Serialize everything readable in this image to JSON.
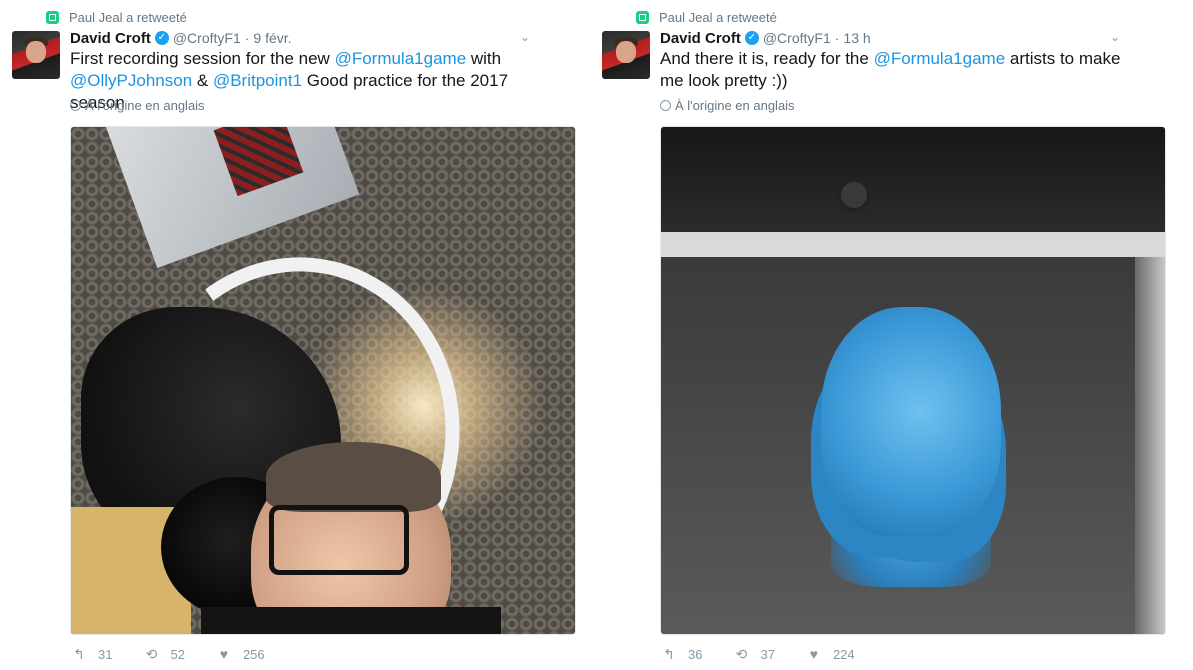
{
  "tweets": [
    {
      "retweet_label": "Paul Jeal a retweeté",
      "author": {
        "name": "David Croft",
        "handle": "@CroftyF1"
      },
      "time": "9 févr.",
      "text_parts": [
        {
          "t": "First recording session for the new "
        },
        {
          "t": "@Formula1game"
        },
        {
          "t": " with "
        },
        {
          "t": "@OllyPJohnson"
        },
        {
          "t": " & "
        },
        {
          "t": "@Britpoint1"
        },
        {
          "t": " Good practice for the 2017 season"
        }
      ],
      "translate": "À l'origine en anglais",
      "counts": {
        "replies": "31",
        "retweets": "52",
        "likes": "256"
      }
    },
    {
      "retweet_label": "Paul Jeal a retweeté",
      "author": {
        "name": "David Croft",
        "handle": "@CroftyF1"
      },
      "time": "13 h",
      "text_parts": [
        {
          "t": "And there it is, ready for the "
        },
        {
          "t": "@Formula1game"
        },
        {
          "t": " artists to make me look pretty :))"
        }
      ],
      "translate": "À l'origine en anglais",
      "counts": {
        "replies": "36",
        "retweets": "37",
        "likes": "224"
      }
    }
  ],
  "icons": {
    "retweet_indicator": "retweet-icon",
    "verified": "verified-icon",
    "more": "chevron-down-icon",
    "reply": "reply-icon",
    "retweet": "retweet-icon",
    "like": "heart-icon",
    "translate": "globe-icon"
  },
  "colors": {
    "accent": "#1b95e0",
    "retweet_green": "#19cf86",
    "muted": "#657786"
  }
}
